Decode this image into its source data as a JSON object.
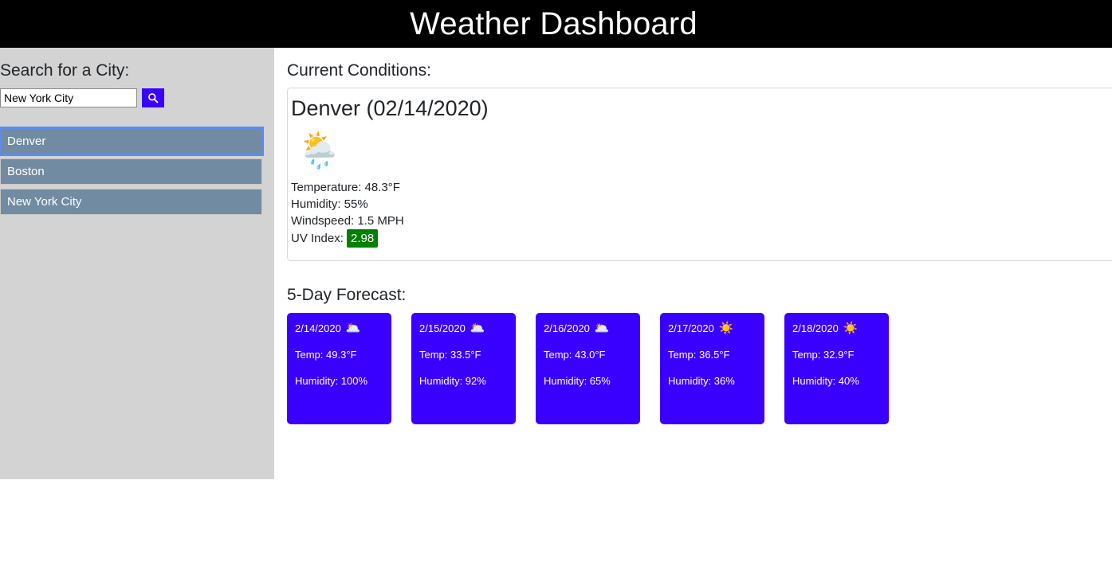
{
  "header": {
    "title": "Weather Dashboard"
  },
  "sidebar": {
    "search_label": "Search for a City:",
    "search": {
      "value": "New York City",
      "placeholder": "Search for a City",
      "button_icon": "search-icon"
    },
    "cities": [
      {
        "name": "Denver",
        "active": true
      },
      {
        "name": "Boston",
        "active": false
      },
      {
        "name": "New York City",
        "active": false
      }
    ]
  },
  "main": {
    "current_heading": "Current Conditions:",
    "current": {
      "city_date": "Denver (02/14/2020)",
      "icon": "sun-behind-rain-cloud-icon",
      "icon_glyph": "🌦️",
      "temperature": "Temperature: 48.3°F",
      "humidity": "Humidity: 55%",
      "windspeed": "Windspeed: 1.5 MPH",
      "uv_label": "UV Index:",
      "uv_value": "2.98",
      "uv_color": "#008000"
    },
    "forecast_heading": "5-Day Forecast:",
    "forecast": [
      {
        "date": "2/14/2020",
        "icon": "broken-clouds-icon",
        "icon_glyph": "🌥️",
        "temp": "Temp: 49.3°F",
        "humidity": "Humidity: 100%"
      },
      {
        "date": "2/15/2020",
        "icon": "broken-clouds-icon",
        "icon_glyph": "🌥️",
        "temp": "Temp: 33.5°F",
        "humidity": "Humidity: 92%"
      },
      {
        "date": "2/16/2020",
        "icon": "broken-clouds-icon",
        "icon_glyph": "🌥️",
        "temp": "Temp: 43.0°F",
        "humidity": "Humidity: 65%"
      },
      {
        "date": "2/17/2020",
        "icon": "sun-icon",
        "icon_glyph": "☀️",
        "temp": "Temp: 36.5°F",
        "humidity": "Humidity: 36%"
      },
      {
        "date": "2/18/2020",
        "icon": "sun-icon",
        "icon_glyph": "☀️",
        "temp": "Temp: 32.9°F",
        "humidity": "Humidity: 40%"
      }
    ]
  },
  "colors": {
    "header_bg": "#000000",
    "sidebar_bg": "#d3d3d3",
    "accent_blue": "#3a00ff",
    "city_button": "#718ba3",
    "uv_green": "#008000"
  }
}
